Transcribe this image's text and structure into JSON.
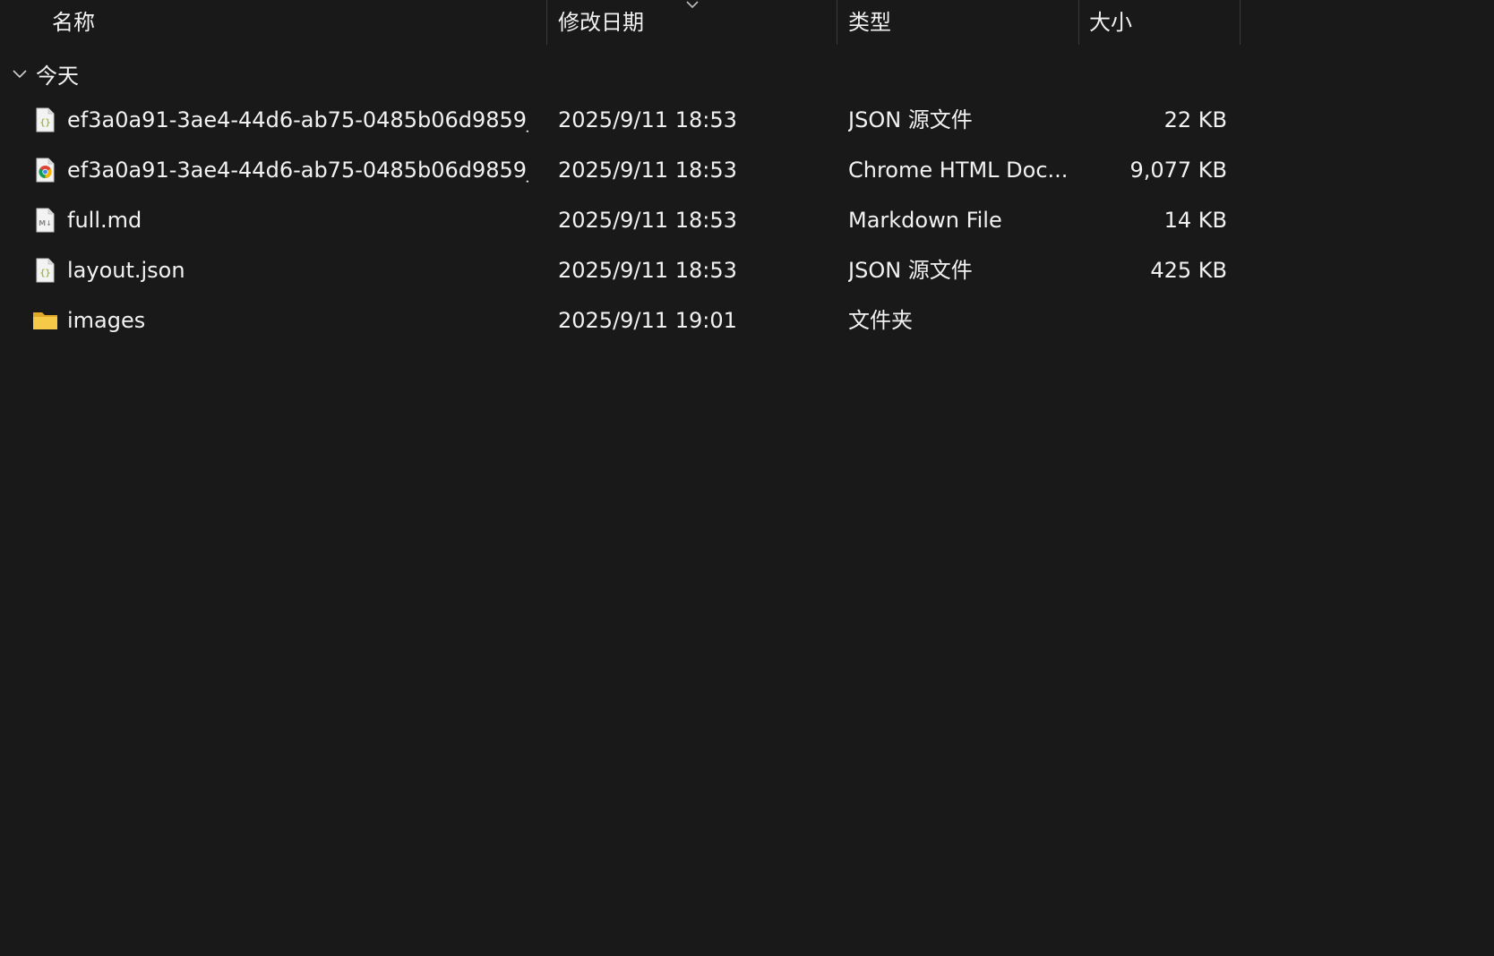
{
  "columns": {
    "name": "名称",
    "modified": "修改日期",
    "type": "类型",
    "size": "大小"
  },
  "sort": {
    "column": "modified",
    "indicator": "chevron-down-icon"
  },
  "group": {
    "label": "今天",
    "expanded": true
  },
  "files": [
    {
      "name": "ef3a0a91-3ae4-44d6-ab75-0485b06d9859_...",
      "modified": "2025/9/11 18:53",
      "type": "JSON 源文件",
      "size": "22 KB",
      "icon": "json-file-icon"
    },
    {
      "name": "ef3a0a91-3ae4-44d6-ab75-0485b06d9859_...",
      "modified": "2025/9/11 18:53",
      "type": "Chrome HTML Doc...",
      "size": "9,077 KB",
      "icon": "chrome-html-icon"
    },
    {
      "name": "full.md",
      "modified": "2025/9/11 18:53",
      "type": "Markdown File",
      "size": "14 KB",
      "icon": "markdown-file-icon"
    },
    {
      "name": "layout.json",
      "modified": "2025/9/11 18:53",
      "type": "JSON 源文件",
      "size": "425 KB",
      "icon": "json-file-icon"
    },
    {
      "name": "images",
      "modified": "2025/9/11 19:01",
      "type": "文件夹",
      "size": "",
      "icon": "folder-icon"
    }
  ],
  "colors": {
    "background": "#191919",
    "text": "#f2f2f2",
    "separator": "#3a3a3a",
    "folder": "#f4c542",
    "json_brace": "#9bbd3a"
  }
}
